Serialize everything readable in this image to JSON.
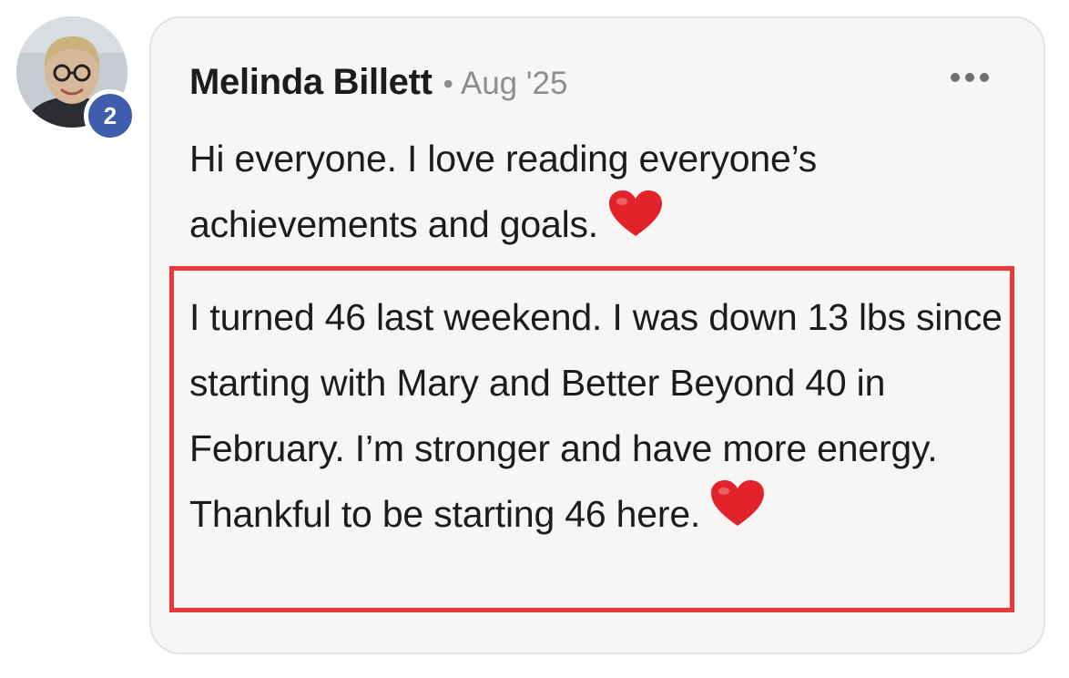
{
  "comment": {
    "author": "Melinda Billett",
    "separator": "•",
    "date": "Aug '25",
    "badge_count": "2",
    "paragraphs": [
      "Hi everyone. I love reading everyone’s achievements and goals.",
      "I turned 46 last weekend. I was down 13 lbs since starting with Mary and Better Beyond 40 in February. I’m stronger and have more energy. Thankful to be starting 46 here."
    ],
    "emoji": "red-heart",
    "menu_icon": "more-horizontal-icon"
  },
  "colors": {
    "card_background": "#f7f6f4",
    "badge": "#3f5dad",
    "highlight_border": "#e8383c",
    "heart": "#e3232b",
    "muted_text": "#8e8e8e"
  }
}
